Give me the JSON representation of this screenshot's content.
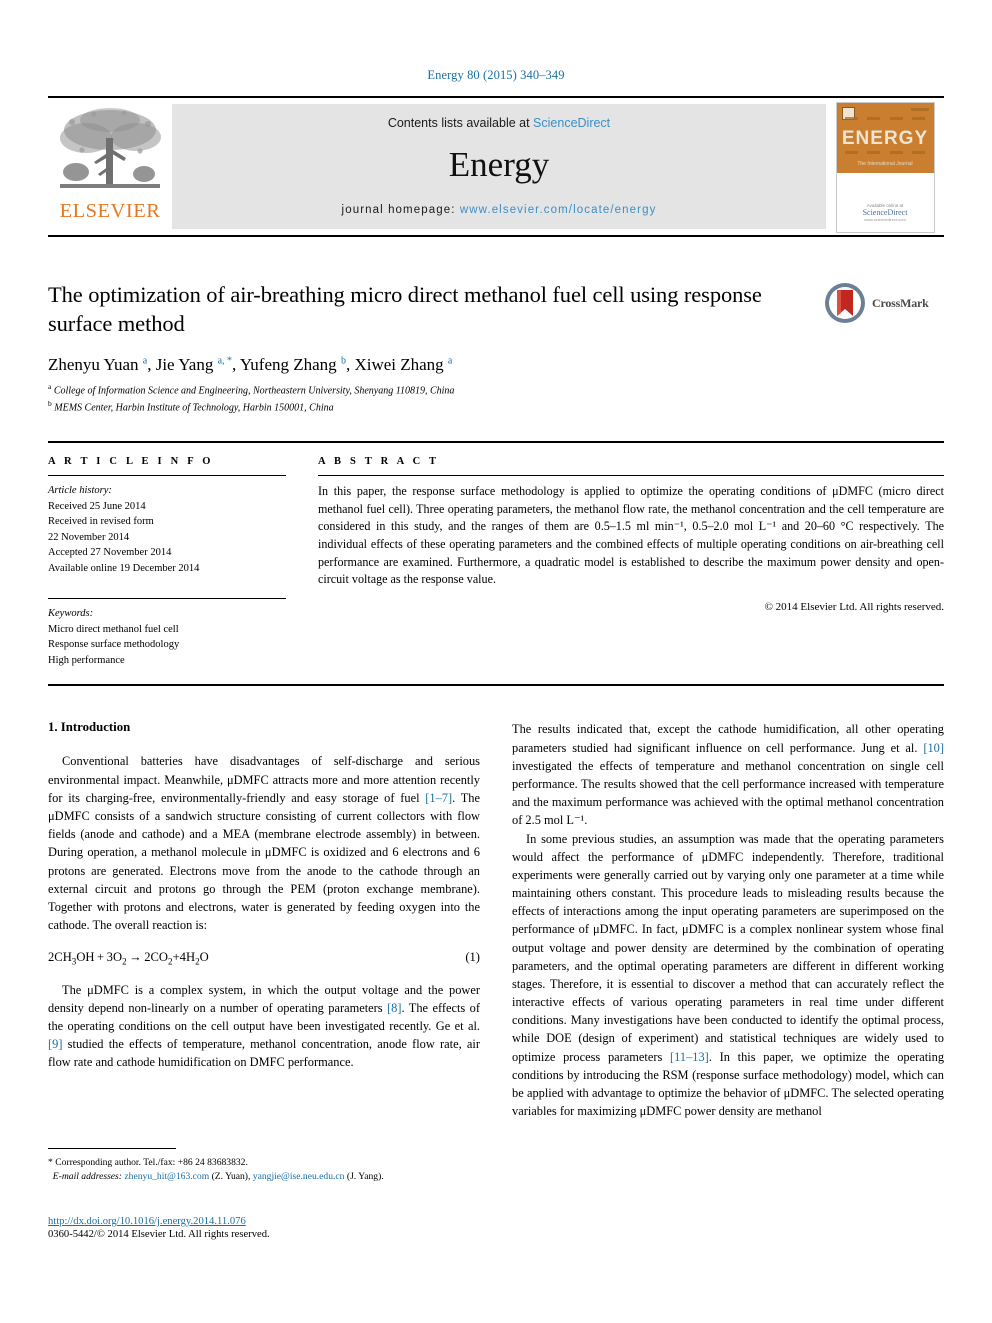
{
  "running_head": "Energy 80 (2015) 340–349",
  "banner": {
    "publisher_name": "ELSEVIER",
    "contents_prefix": "Contents lists available at ",
    "contents_link": "ScienceDirect",
    "journal_name": "Energy",
    "homepage_prefix": "journal homepage: ",
    "homepage_url": "www.elsevier.com/locate/energy",
    "cover_title": "ENERGY",
    "cover_subtitle": "The International Journal",
    "cover_footer_small": "Available online at",
    "cover_footer_brand": "ScienceDirect",
    "cover_footer_url": "www.sciencedirect.com"
  },
  "article": {
    "title": "The optimization of air-breathing micro direct methanol fuel cell using response surface method",
    "crossmark_label": "CrossMark",
    "authors_html": "Zhenyu Yuan <sup>a</sup>, Jie Yang <sup>a, *</sup>, Yufeng Zhang <sup>b</sup>, Xiwei Zhang <sup>a</sup>",
    "affiliations": [
      {
        "marker": "a",
        "text": "College of Information Science and Engineering, Northeastern University, Shenyang 110819, China"
      },
      {
        "marker": "b",
        "text": "MEMS Center, Harbin Institute of Technology, Harbin 150001, China"
      }
    ]
  },
  "article_info": {
    "heading": "A R T I C L E  I N F O",
    "history_label": "Article history:",
    "history": [
      "Received 25 June 2014",
      "Received in revised form",
      "22 November 2014",
      "Accepted 27 November 2014",
      "Available online 19 December 2014"
    ],
    "keywords_label": "Keywords:",
    "keywords": [
      "Micro direct methanol fuel cell",
      "Response surface methodology",
      "High performance"
    ]
  },
  "abstract": {
    "heading": "A B S T R A C T",
    "body": "In this paper, the response surface methodology is applied to optimize the operating conditions of μDMFC (micro direct methanol fuel cell). Three operating parameters, the methanol flow rate, the methanol concentration and the cell temperature are considered in this study, and the ranges of them are 0.5–1.5 ml min⁻¹, 0.5–2.0 mol L⁻¹ and 20–60 °C respectively. The individual effects of these operating parameters and the combined effects of multiple operating conditions on air-breathing cell performance are examined. Furthermore, a quadratic model is established to describe the maximum power density and open-circuit voltage as the response value.",
    "copyright": "© 2014 Elsevier Ltd. All rights reserved."
  },
  "body": {
    "section_title": "1. Introduction",
    "left_para_1_a": "Conventional batteries have disadvantages of self-discharge and serious environmental impact. Meanwhile, μDMFC attracts more and more attention recently for its charging-free, environmentally-friendly and easy storage of fuel ",
    "left_para_1_ref": "[1–7]",
    "left_para_1_b": ". The μDMFC consists of a sandwich structure consisting of current collectors with flow fields (anode and cathode) and a MEA (membrane electrode assembly) in between. During operation, a methanol molecule in μDMFC is oxidized and 6 electrons and 6 protons are generated. Electrons move from the anode to the cathode through an external circuit and protons go through the PEM (proton exchange membrane). Together with protons and electrons, water is generated by feeding oxygen into the cathode. The overall reaction is:",
    "equation_text": "2CH3OH + 3O2 → 2CO2+4H2O",
    "equation_number": "(1)",
    "left_para_2_a": "The μDMFC is a complex system, in which the output voltage and the power density depend non-linearly on a number of operating parameters ",
    "left_para_2_ref1": "[8]",
    "left_para_2_b": ". The effects of the operating conditions on the cell output have been investigated recently. Ge et al. ",
    "left_para_2_ref2": "[9]",
    "left_para_2_c": " studied the effects of temperature, methanol concentration, anode flow rate, air flow rate and cathode humidification on DMFC performance.",
    "right_para_1_a": "The results indicated that, except the cathode humidification, all other operating parameters studied had significant influence on cell performance. Jung et al. ",
    "right_para_1_ref": "[10]",
    "right_para_1_b": " investigated the effects of temperature and methanol concentration on single cell performance. The results showed that the cell performance increased with temperature and the maximum performance was achieved with the optimal methanol concentration of 2.5 mol L⁻¹.",
    "right_para_2_a": "In some previous studies, an assumption was made that the operating parameters would affect the performance of μDMFC independently. Therefore, traditional experiments were generally carried out by varying only one parameter at a time while maintaining others constant. This procedure leads to misleading results because the effects of interactions among the input operating parameters are superimposed on the performance of μDMFC. In fact, μDMFC is a complex nonlinear system whose final output voltage and power density are determined by the combination of operating parameters, and the optimal operating parameters are different in different working stages. Therefore, it is essential to discover a method that can accurately reflect the interactive effects of various operating parameters in real time under different conditions. Many investigations have been conducted to identify the optimal process, while DOE (design of experiment) and statistical techniques are widely used to optimize process parameters ",
    "right_para_2_ref": "[11–13]",
    "right_para_2_b": ". In this paper, we optimize the operating conditions by introducing the RSM (response surface methodology) model, which can be applied with advantage to optimize the behavior of μDMFC. The selected operating variables for maximizing μDMFC power density are methanol"
  },
  "footnote": {
    "star": "*",
    "corresponding": " Corresponding author. Tel./fax: +86 24 83683832.",
    "email_label": "E-mail addresses:",
    "email1": "zhenyu_hit@163.com",
    "email1_owner": " (Z. Yuan), ",
    "email2": "yangjie@ise.neu.edu.cn",
    "email2_owner": " (J. Yang)."
  },
  "doi": {
    "url": "http://dx.doi.org/10.1016/j.energy.2014.11.076",
    "copyright": "0360-5442/© 2014 Elsevier Ltd. All rights reserved."
  },
  "colors": {
    "link_blue": "#1a6fa3",
    "sciencedirect_blue": "#3a8fc4",
    "elsevier_orange": "#e87722",
    "banner_grey": "#e4e4e4",
    "cover_orange": "#c97e30",
    "crossmark_red": "#c0271f"
  }
}
